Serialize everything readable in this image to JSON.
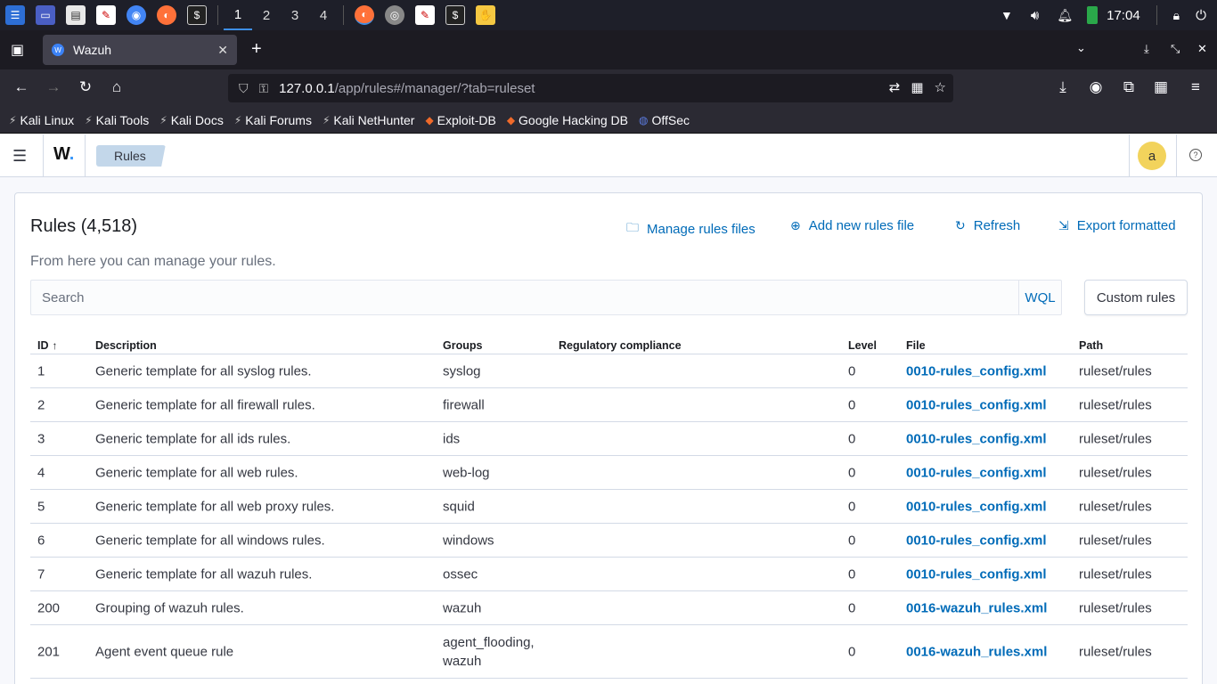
{
  "taskbar": {
    "workspaces": [
      "1",
      "2",
      "3",
      "4"
    ],
    "clock": "17:04"
  },
  "browser": {
    "tab_title": "Wazuh",
    "url_host": "127.0.0.1",
    "url_path": "/app/rules#/manager/?tab=ruleset",
    "bookmarks": [
      "Kali Linux",
      "Kali Tools",
      "Kali Docs",
      "Kali Forums",
      "Kali NetHunter",
      "Exploit-DB",
      "Google Hacking DB",
      "OffSec"
    ]
  },
  "app": {
    "logo_text": "W",
    "breadcrumb": "Rules",
    "avatar_letter": "a"
  },
  "panel": {
    "title": "Rules (4,518)",
    "subtitle": "From here you can manage your rules.",
    "actions": {
      "manage": "Manage rules files",
      "add": "Add new rules file",
      "refresh": "Refresh",
      "export": "Export formatted"
    },
    "search_placeholder": "Search",
    "wql_label": "WQL",
    "custom_rules_label": "Custom rules"
  },
  "table": {
    "headers": {
      "id": "ID",
      "description": "Description",
      "groups": "Groups",
      "regulatory": "Regulatory compliance",
      "level": "Level",
      "file": "File",
      "path": "Path"
    },
    "rows": [
      {
        "id": "1",
        "description": "Generic template for all syslog rules.",
        "groups": "syslog",
        "regulatory": "",
        "level": "0",
        "file": "0010-rules_config.xml",
        "path": "ruleset/rules"
      },
      {
        "id": "2",
        "description": "Generic template for all firewall rules.",
        "groups": "firewall",
        "regulatory": "",
        "level": "0",
        "file": "0010-rules_config.xml",
        "path": "ruleset/rules"
      },
      {
        "id": "3",
        "description": "Generic template for all ids rules.",
        "groups": "ids",
        "regulatory": "",
        "level": "0",
        "file": "0010-rules_config.xml",
        "path": "ruleset/rules"
      },
      {
        "id": "4",
        "description": "Generic template for all web rules.",
        "groups": "web-log",
        "regulatory": "",
        "level": "0",
        "file": "0010-rules_config.xml",
        "path": "ruleset/rules"
      },
      {
        "id": "5",
        "description": "Generic template for all web proxy rules.",
        "groups": "squid",
        "regulatory": "",
        "level": "0",
        "file": "0010-rules_config.xml",
        "path": "ruleset/rules"
      },
      {
        "id": "6",
        "description": "Generic template for all windows rules.",
        "groups": "windows",
        "regulatory": "",
        "level": "0",
        "file": "0010-rules_config.xml",
        "path": "ruleset/rules"
      },
      {
        "id": "7",
        "description": "Generic template for all wazuh rules.",
        "groups": "ossec",
        "regulatory": "",
        "level": "0",
        "file": "0010-rules_config.xml",
        "path": "ruleset/rules"
      },
      {
        "id": "200",
        "description": "Grouping of wazuh rules.",
        "groups": "wazuh",
        "regulatory": "",
        "level": "0",
        "file": "0016-wazuh_rules.xml",
        "path": "ruleset/rules"
      },
      {
        "id": "201",
        "description": "Agent event queue rule",
        "groups_lines": [
          "agent_flooding,",
          "wazuh"
        ],
        "regulatory": "",
        "level": "0",
        "file": "0016-wazuh_rules.xml",
        "path": "ruleset/rules"
      }
    ]
  }
}
